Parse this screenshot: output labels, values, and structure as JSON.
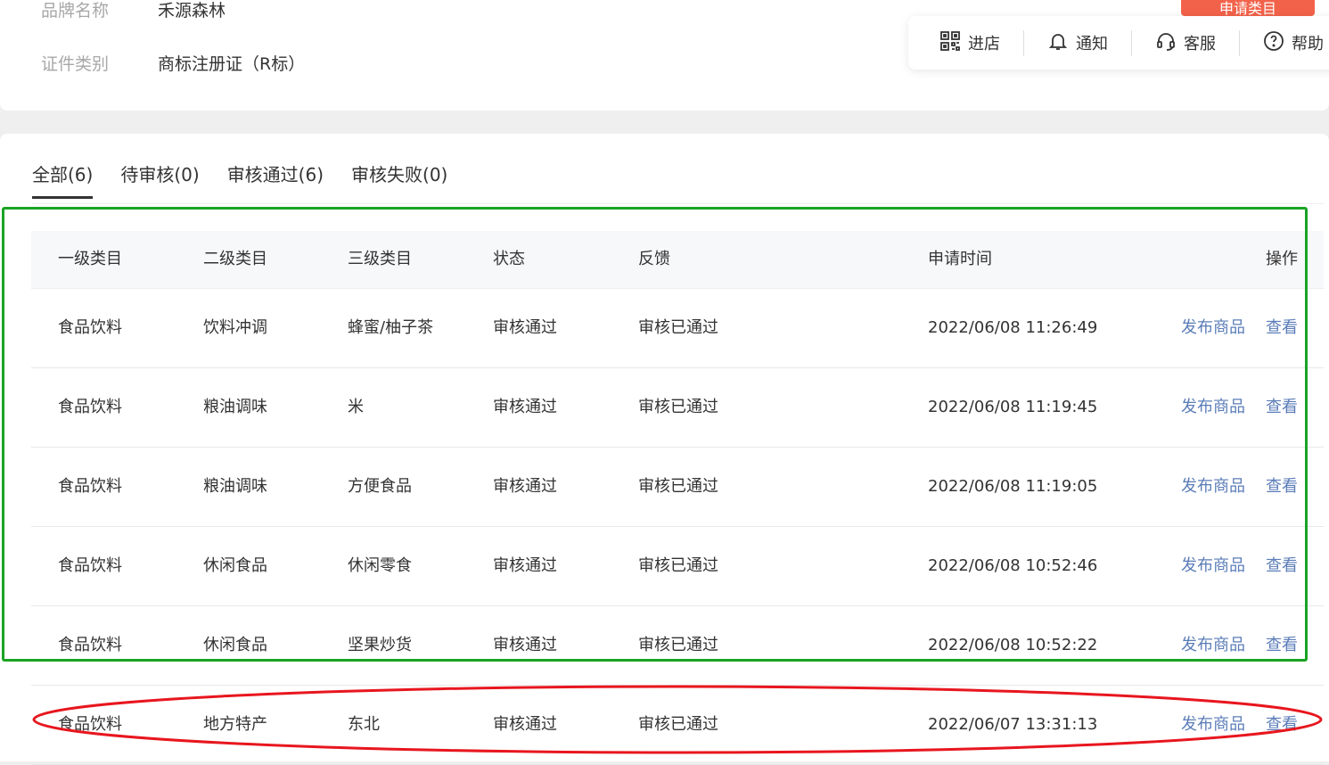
{
  "brand": {
    "name_label": "品牌名称",
    "name_value": "禾源森林",
    "cert_label": "证件类别",
    "cert_value": "商标注册证（R标）",
    "apply_button": "申请类目"
  },
  "toolbar": {
    "enter_store": "进店",
    "notify": "通知",
    "service": "客服",
    "help": "帮助"
  },
  "tabs": [
    {
      "label": "全部(6)"
    },
    {
      "label": "待审核(0)"
    },
    {
      "label": "审核通过(6)"
    },
    {
      "label": "审核失败(0)"
    }
  ],
  "table": {
    "headers": {
      "level1": "一级类目",
      "level2": "二级类目",
      "level3": "三级类目",
      "status": "状态",
      "feedback": "反馈",
      "time": "申请时间",
      "action": "操作"
    },
    "rows": [
      {
        "l1": "食品饮料",
        "l2": "饮料冲调",
        "l3": "蜂蜜/柚子茶",
        "status": "审核通过",
        "feedback": "审核已通过",
        "time": "2022/06/08 11:26:49",
        "publish": "发布商品",
        "view": "查看"
      },
      {
        "l1": "食品饮料",
        "l2": "粮油调味",
        "l3": "米",
        "status": "审核通过",
        "feedback": "审核已通过",
        "time": "2022/06/08 11:19:45",
        "publish": "发布商品",
        "view": "查看"
      },
      {
        "l1": "食品饮料",
        "l2": "粮油调味",
        "l3": "方便食品",
        "status": "审核通过",
        "feedback": "审核已通过",
        "time": "2022/06/08 11:19:05",
        "publish": "发布商品",
        "view": "查看"
      },
      {
        "l1": "食品饮料",
        "l2": "休闲食品",
        "l3": "休闲零食",
        "status": "审核通过",
        "feedback": "审核已通过",
        "time": "2022/06/08 10:52:46",
        "publish": "发布商品",
        "view": "查看"
      },
      {
        "l1": "食品饮料",
        "l2": "休闲食品",
        "l3": "坚果炒货",
        "status": "审核通过",
        "feedback": "审核已通过",
        "time": "2022/06/08 10:52:22",
        "publish": "发布商品",
        "view": "查看"
      },
      {
        "l1": "食品饮料",
        "l2": "地方特产",
        "l3": "东北",
        "status": "审核通过",
        "feedback": "审核已通过",
        "time": "2022/06/07 13:31:13",
        "publish": "发布商品",
        "view": "查看"
      }
    ]
  },
  "colors": {
    "link": "#5b7db8",
    "apply_button": "#f2624a",
    "green_highlight": "#1aa324",
    "red_highlight": "#e8161e"
  }
}
